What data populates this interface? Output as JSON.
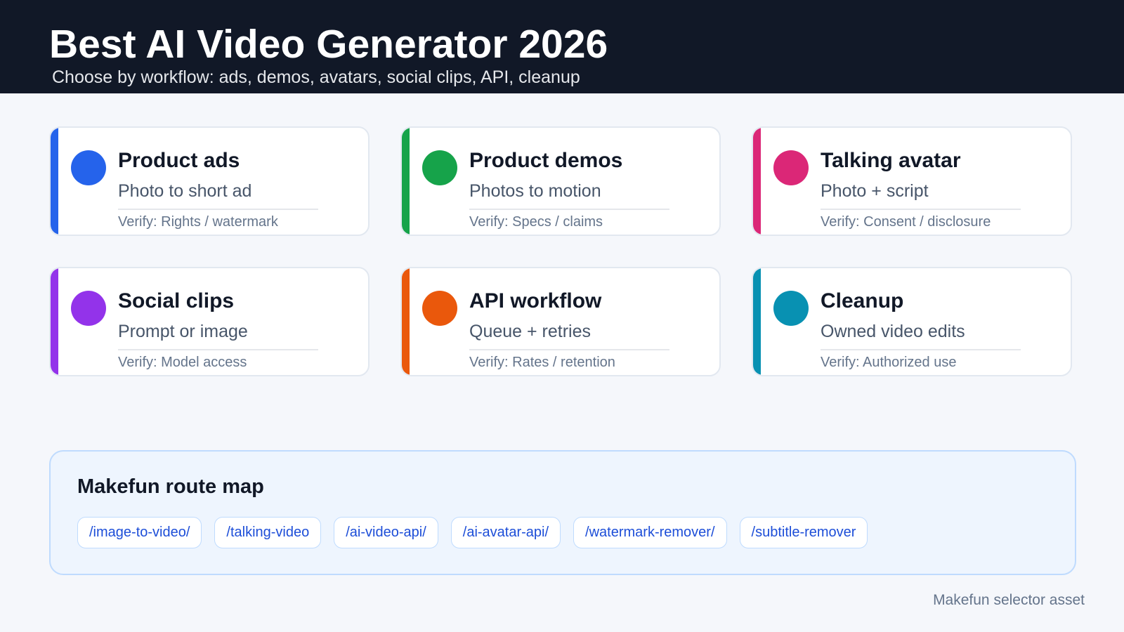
{
  "header": {
    "title": "Best AI Video Generator 2026",
    "subtitle": "Choose by workflow: ads, demos, avatars, social clips, API, cleanup"
  },
  "cards": [
    {
      "title": "Product ads",
      "desc": "Photo to short ad",
      "verify": "Verify: Rights / watermark",
      "color": "#2563eb"
    },
    {
      "title": "Product demos",
      "desc": "Photos to motion",
      "verify": "Verify: Specs / claims",
      "color": "#16a34a"
    },
    {
      "title": "Talking avatar",
      "desc": "Photo + script",
      "verify": "Verify: Consent / disclosure",
      "color": "#db2777"
    },
    {
      "title": "Social clips",
      "desc": "Prompt or image",
      "verify": "Verify: Model access",
      "color": "#9333ea"
    },
    {
      "title": "API workflow",
      "desc": "Queue + retries",
      "verify": "Verify: Rates / retention",
      "color": "#ea580c"
    },
    {
      "title": "Cleanup",
      "desc": "Owned video edits",
      "verify": "Verify: Authorized use",
      "color": "#0891b2"
    }
  ],
  "route_map": {
    "title": "Makefun route map",
    "routes": [
      "/image-to-video/",
      "/talking-video",
      "/ai-video-api/",
      "/ai-avatar-api/",
      "/watermark-remover/",
      "/subtitle-remover"
    ]
  },
  "footer": {
    "note": "Makefun selector asset"
  }
}
